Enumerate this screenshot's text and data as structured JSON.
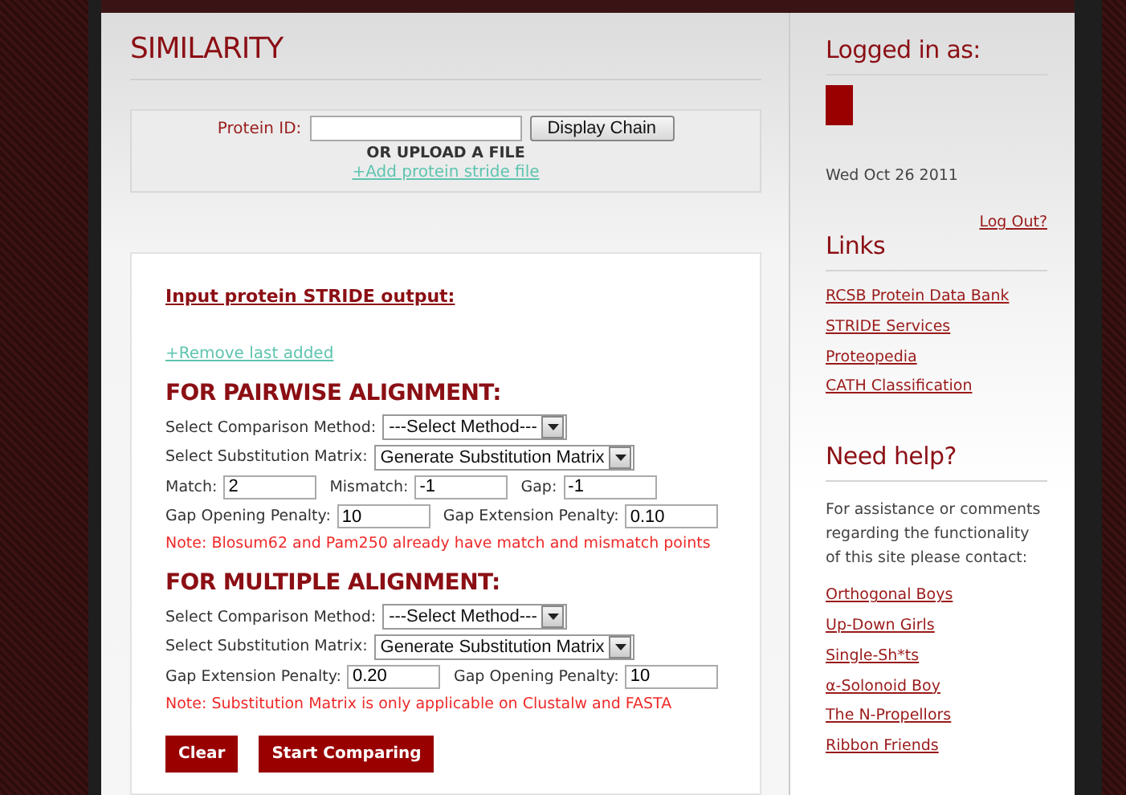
{
  "page": {
    "title": "SIMILARITY"
  },
  "protein_lookup": {
    "label": "Protein ID:",
    "button": "Display Chain",
    "or_text": "OR UPLOAD A FILE",
    "add_link": "+Add protein stride file"
  },
  "stride": {
    "heading": "Input protein STRIDE output:",
    "remove_link": "+Remove last added"
  },
  "sections": [
    {
      "heading": "FOR PAIRWISE ALIGNMENT:",
      "lines": [
        {
          "fields": [
            {
              "kind": "select",
              "label": "Select Comparison Method:",
              "value": "---Select Method---"
            }
          ]
        },
        {
          "fields": [
            {
              "kind": "select",
              "label": "Select Substitution Matrix:",
              "value": "Generate Substitution Matrix"
            }
          ]
        },
        {
          "fields": [
            {
              "kind": "input",
              "label": "Match:",
              "value": "2"
            },
            {
              "kind": "input",
              "label": "Mismatch:",
              "value": "-1"
            },
            {
              "kind": "input",
              "label": "Gap:",
              "value": "-1"
            }
          ]
        },
        {
          "fields": [
            {
              "kind": "input",
              "label": "Gap Opening Penalty:",
              "value": "10"
            },
            {
              "kind": "input",
              "label": "Gap Extension Penalty:",
              "value": "0.10"
            }
          ]
        }
      ],
      "note": "Note: Blosum62 and Pam250 already have match and mismatch points"
    },
    {
      "heading": "FOR MULTIPLE ALIGNMENT:",
      "lines": [
        {
          "fields": [
            {
              "kind": "select",
              "label": "Select Comparison Method:",
              "value": "---Select Method---"
            }
          ]
        },
        {
          "fields": [
            {
              "kind": "select",
              "label": "Select Substitution Matrix:",
              "value": "Generate Substitution Matrix"
            }
          ]
        },
        {
          "fields": [
            {
              "kind": "input",
              "label": "Gap Extension Penalty:",
              "value": "0.20"
            },
            {
              "kind": "input",
              "label": "Gap Opening Penalty:",
              "value": "10"
            }
          ]
        }
      ],
      "note": "Note: Substitution Matrix is only applicable on Clustalw and FASTA"
    }
  ],
  "buttons": [
    "Clear",
    "Start Comparing"
  ],
  "sidebar": {
    "logged_in_heading": "Logged in as:",
    "date": "Wed Oct 26 2011",
    "logout": "Log Out?",
    "links_heading": "Links",
    "links": [
      "RCSB Protein Data Bank",
      "STRIDE Services",
      "Proteopedia",
      "CATH Classification"
    ],
    "help_heading": "Need help?",
    "help_text": "For assistance or comments regarding the functionality of this site please contact:",
    "contacts": [
      "Orthogonal Boys",
      "Up-Down Girls",
      "Single-Sh*ts",
      "α-Solonoid Boy",
      "The N-Propellors",
      "Ribbon Friends"
    ]
  }
}
